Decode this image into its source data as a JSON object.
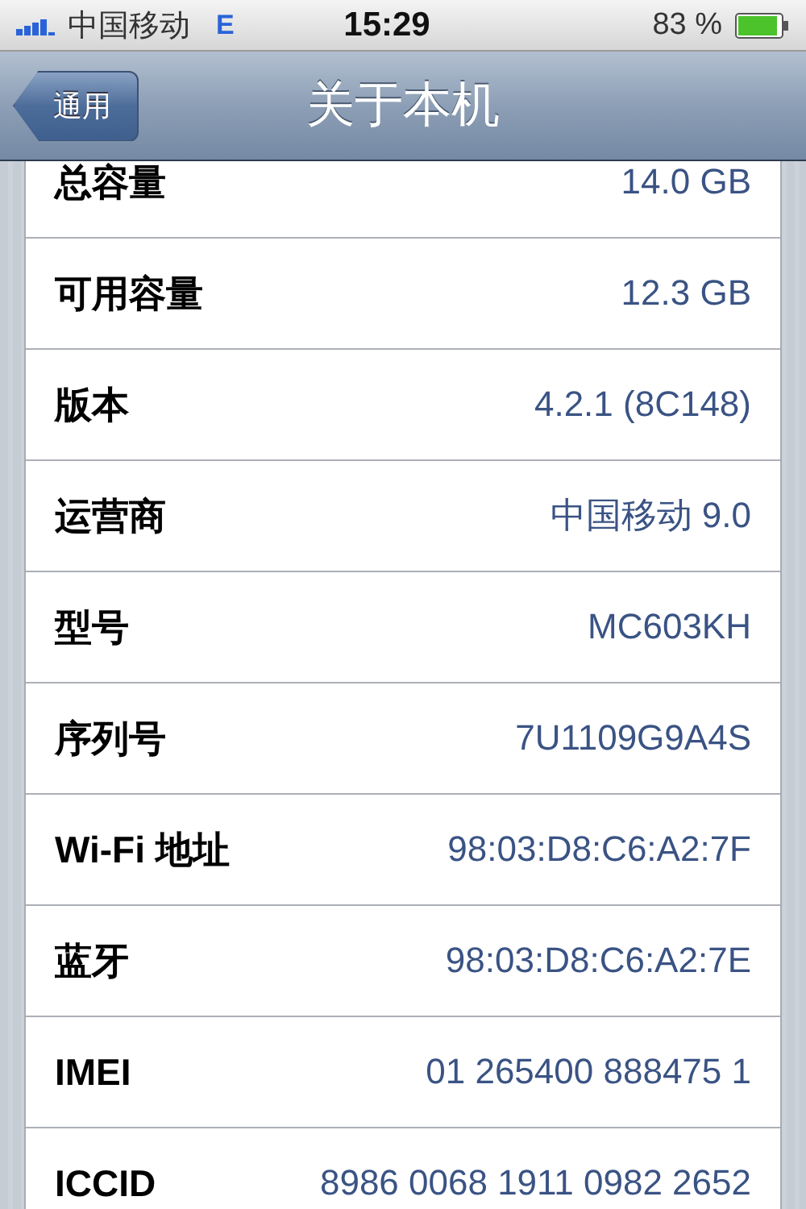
{
  "status_bar": {
    "carrier": "中国移动",
    "network": "E",
    "time": "15:29",
    "battery": "83 %"
  },
  "nav_bar": {
    "back": "通用",
    "title": "关于本机"
  },
  "rows": [
    {
      "label": "总容量",
      "value": "14.0 GB"
    },
    {
      "label": "可用容量",
      "value": "12.3 GB"
    },
    {
      "label": "版本",
      "value": "4.2.1 (8C148)"
    },
    {
      "label": "运营商",
      "value": "中国移动 9.0"
    },
    {
      "label": "型号",
      "value": "MC603KH"
    },
    {
      "label": "序列号",
      "value": "7U1109G9A4S"
    },
    {
      "label": "Wi-Fi 地址",
      "value": "98:03:D8:C6:A2:7F"
    },
    {
      "label": "蓝牙",
      "value": "98:03:D8:C6:A2:7E"
    },
    {
      "label": "IMEI",
      "value": "01 265400 888475 1"
    },
    {
      "label": "ICCID",
      "value": "8986 0068 1911 0982 2652"
    }
  ]
}
